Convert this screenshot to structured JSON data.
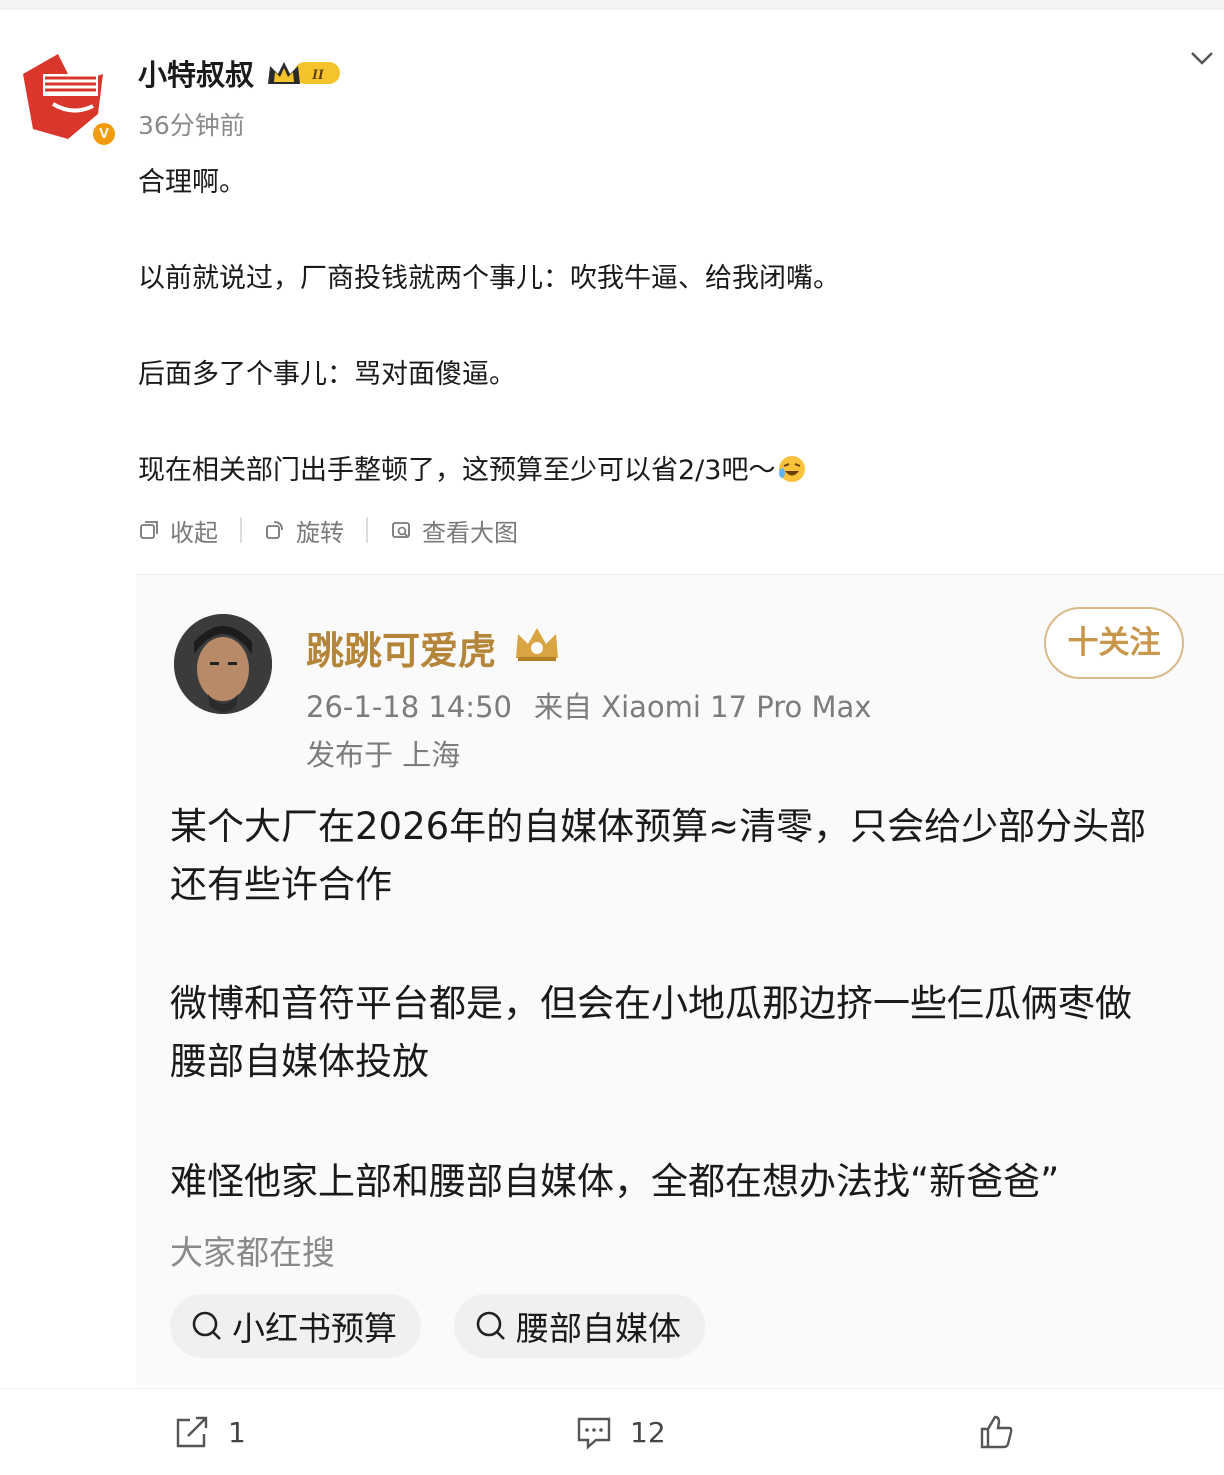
{
  "colors": {
    "gold_name": "#b5863a",
    "follow": "#c9974b",
    "verified": "#f39b0f",
    "meta_gray": "#7c7c7c"
  },
  "outer_post": {
    "author": "小特叔叔",
    "time": "36分钟前",
    "lines": [
      "合理啊。",
      "以前就说过，厂商投钱就两个事儿：吹我牛逼、给我闭嘴。",
      "后面多了个事儿：骂对面傻逼。",
      "现在相关部门出手整顿了，这预算至少可以省2/3吧～"
    ],
    "actions": [
      "收起",
      "旋转",
      "查看大图"
    ],
    "icons": {
      "verified": "verified-v-icon",
      "crown": "crown-level-badge-icon",
      "more": "chevron-down-icon",
      "emoji": "laughing-emoji-icon"
    }
  },
  "quoted_post": {
    "author": "跳跳可爱虎",
    "follow_label": "十关注",
    "datetime": "26-1-18 14:50",
    "source": "来自 Xiaomi 17 Pro Max",
    "location": "发布于 上海",
    "paragraphs": [
      [
        "某个大厂在2026年的自媒体预算≈清零，只会给少部分头部",
        "还有些许合作"
      ],
      [
        "微博和音符平台都是，但会在小地瓜那边挤一些仨瓜俩枣做",
        "腰部自媒体投放"
      ],
      [
        "难怪他家上部和腰部自媒体，全都在想办法找“新爸爸”"
      ]
    ],
    "hot_search_label": "大家都在搜",
    "hot_tags": [
      "小红书预算",
      "腰部自媒体"
    ]
  },
  "bottom_bar": {
    "repost_count": "1",
    "comment_count": "12"
  }
}
